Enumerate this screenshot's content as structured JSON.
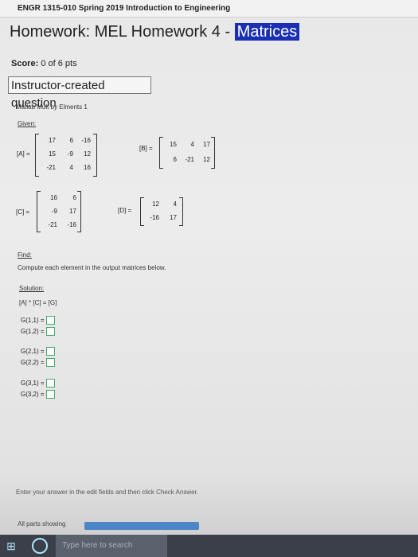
{
  "header": {
    "course": "ENGR 1315-010 Spring 2019 Introduction to Engineering"
  },
  "title": {
    "prefix": "Homework: MEL Homework 4 -",
    "highlight": "Matrices"
  },
  "score": {
    "label": "Score:",
    "value": "0 of 6 pts"
  },
  "question_type": "Instructor-created question",
  "problem": {
    "name": "Matlab Mult by Elments 1",
    "given_label": "Given:",
    "matrices": {
      "A": {
        "label": "[A] =",
        "rows": [
          [
            "17",
            "6",
            "-16"
          ],
          [
            "15",
            "-9",
            "12"
          ],
          [
            "-21",
            "4",
            "16"
          ]
        ]
      },
      "B": {
        "label": "[B] =",
        "rows": [
          [
            "15",
            "4",
            "17"
          ],
          [
            "6",
            "-21",
            "12"
          ]
        ]
      },
      "C": {
        "label": "[C] =",
        "rows": [
          [
            "16",
            "6"
          ],
          [
            "-9",
            "17"
          ],
          [
            "-21",
            "-16"
          ]
        ]
      },
      "D": {
        "label": "[D] =",
        "rows": [
          [
            "12",
            "4"
          ],
          [
            "-16",
            "17"
          ]
        ]
      }
    },
    "find_label": "Find:",
    "find_text": "Compute each element in the output matrices below.",
    "solution_label": "Solution:",
    "equation": "[A] * [C] = [G]",
    "answers": [
      {
        "label": "G(1,1) ="
      },
      {
        "label": "G(1,2) ="
      },
      {
        "label": "G(2,1) ="
      },
      {
        "label": "G(2,2) ="
      },
      {
        "label": "G(3,1) ="
      },
      {
        "label": "G(3,2) ="
      }
    ]
  },
  "footer": {
    "instruction": "Enter your answer in the edit fields and then click Check Answer.",
    "parts_label": "All parts showing",
    "parts_progress": 1.0
  },
  "taskbar": {
    "search_placeholder": "Type here to search",
    "start_icon": "windows-logo-icon"
  }
}
